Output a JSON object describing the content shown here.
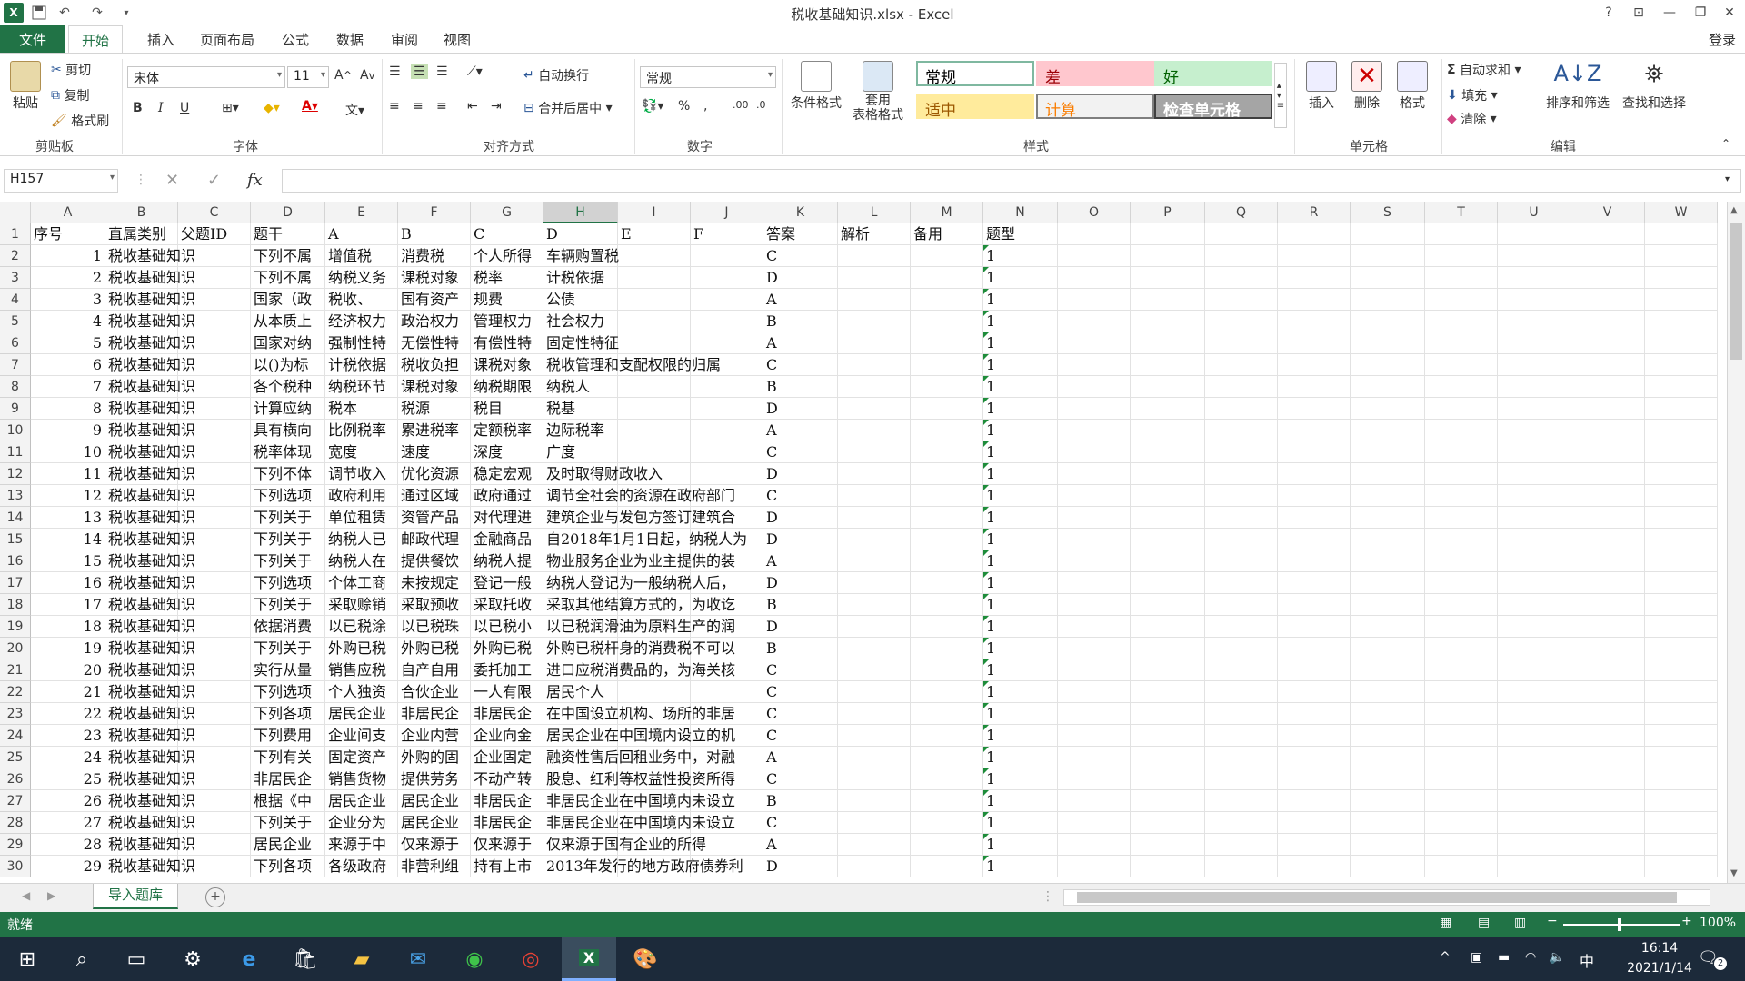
{
  "app": {
    "window_title": "税收基础知识.xlsx - Excel",
    "login": "登录",
    "help": "?",
    "accent": "#217346"
  },
  "tabs": [
    "文件",
    "开始",
    "插入",
    "页面布局",
    "公式",
    "数据",
    "审阅",
    "视图"
  ],
  "ribbon": {
    "clipboard": {
      "paste": "粘贴",
      "cut": "剪切",
      "copy": "复制",
      "format_painter": "格式刷",
      "label": "剪贴板"
    },
    "font": {
      "name": "宋体",
      "size": "11",
      "label": "字体",
      "bold": "B",
      "italic": "I",
      "underline": "U"
    },
    "alignment": {
      "wrap": "自动换行",
      "merge": "合并后居中",
      "label": "对齐方式"
    },
    "number": {
      "format": "常规",
      "label": "数字"
    },
    "styles": {
      "conditional": "条件格式",
      "table": "套用\n表格格式",
      "label": "样式",
      "cells": [
        {
          "text": "常规",
          "bg": "#ffffff",
          "fg": "#000000",
          "border": "#7fb8a0"
        },
        {
          "text": "差",
          "bg": "#ffc7ce",
          "fg": "#9c0006",
          "border": "#ffc7ce"
        },
        {
          "text": "好",
          "bg": "#c6efce",
          "fg": "#006100",
          "border": "#c6efce"
        },
        {
          "text": "适中",
          "bg": "#ffeb9c",
          "fg": "#9c5700",
          "border": "#ffeb9c"
        },
        {
          "text": "计算",
          "bg": "#f2f2f2",
          "fg": "#fa7d00",
          "border": "#7f7f7f"
        },
        {
          "text": "检查单元格",
          "bg": "#a5a5a5",
          "fg": "#ffffff",
          "border": "#3f3f3f"
        }
      ]
    },
    "cells": {
      "insert": "插入",
      "delete": "删除",
      "format": "格式",
      "label": "单元格"
    },
    "editing": {
      "autosum": "自动求和",
      "fill": "填充",
      "clear": "清除",
      "sort": "排序和筛选",
      "find": "查找和选择",
      "label": "编辑"
    }
  },
  "formula_bar": {
    "name_box": "H157",
    "fx": "fx",
    "value": ""
  },
  "columns": [
    "A",
    "B",
    "C",
    "D",
    "E",
    "F",
    "G",
    "H",
    "I",
    "J",
    "K",
    "L",
    "M",
    "N",
    "O",
    "P",
    "Q",
    "R",
    "S",
    "T",
    "U",
    "V",
    "W"
  ],
  "header_row": [
    "序号",
    "直属类别",
    "父题ID",
    "题干",
    "A",
    "B",
    "C",
    "D",
    "E",
    "F",
    "答案",
    "解析",
    "备用",
    "题型"
  ],
  "rows": [
    [
      "1",
      "税收基础知识",
      "",
      "下列不属",
      "增值税",
      "消费税",
      "个人所得",
      "车辆购置税",
      "",
      "",
      "C",
      "",
      "",
      "1"
    ],
    [
      "2",
      "税收基础知识",
      "",
      "下列不属",
      "纳税义务",
      "课税对象",
      "税率",
      "计税依据",
      "",
      "",
      "D",
      "",
      "",
      "1"
    ],
    [
      "3",
      "税收基础知识",
      "",
      "国家（政",
      "税收、",
      "国有资产",
      "规费",
      "公债",
      "",
      "",
      "A",
      "",
      "",
      "1"
    ],
    [
      "4",
      "税收基础知识",
      "",
      "从本质上",
      "经济权力",
      "政治权力",
      "管理权力",
      "社会权力",
      "",
      "",
      "B",
      "",
      "",
      "1"
    ],
    [
      "5",
      "税收基础知识",
      "",
      "国家对纳",
      "强制性特",
      "无偿性特",
      "有偿性特",
      "固定性特征",
      "",
      "",
      "A",
      "",
      "",
      "1"
    ],
    [
      "6",
      "税收基础知识",
      "",
      "以()为标",
      "计税依据",
      "税收负担",
      "课税对象",
      "税收管理和支配权限的归属",
      "",
      "",
      "C",
      "",
      "",
      "1"
    ],
    [
      "7",
      "税收基础知识",
      "",
      "各个税种",
      "纳税环节",
      "课税对象",
      "纳税期限",
      "纳税人",
      "",
      "",
      "B",
      "",
      "",
      "1"
    ],
    [
      "8",
      "税收基础知识",
      "",
      "计算应纳",
      "税本",
      "税源",
      "税目",
      "税基",
      "",
      "",
      "D",
      "",
      "",
      "1"
    ],
    [
      "9",
      "税收基础知识",
      "",
      "具有横向",
      "比例税率",
      "累进税率",
      "定额税率",
      "边际税率",
      "",
      "",
      "A",
      "",
      "",
      "1"
    ],
    [
      "10",
      "税收基础知识",
      "",
      "税率体现",
      "宽度",
      "速度",
      "深度",
      "广度",
      "",
      "",
      "C",
      "",
      "",
      "1"
    ],
    [
      "11",
      "税收基础知识",
      "",
      "下列不体",
      "调节收入",
      "优化资源",
      "稳定宏观",
      "及时取得财政收入",
      "",
      "",
      "D",
      "",
      "",
      "1"
    ],
    [
      "12",
      "税收基础知识",
      "",
      "下列选项",
      "政府利用",
      "通过区域",
      "政府通过",
      "调节全社会的资源在政府部门",
      "",
      "",
      "C",
      "",
      "",
      "1"
    ],
    [
      "13",
      "税收基础知识",
      "",
      "下列关于",
      "单位租赁",
      "资管产品",
      "对代理进",
      "建筑企业与发包方签订建筑合",
      "",
      "",
      "D",
      "",
      "",
      "1"
    ],
    [
      "14",
      "税收基础知识",
      "",
      "下列关于",
      "纳税人已",
      "邮政代理",
      "金融商品",
      "自2018年1月1日起，纳税人为",
      "",
      "",
      "D",
      "",
      "",
      "1"
    ],
    [
      "15",
      "税收基础知识",
      "",
      "下列关于",
      "纳税人在",
      "提供餐饮",
      "纳税人提",
      "物业服务企业为业主提供的装",
      "",
      "",
      "A",
      "",
      "",
      "1"
    ],
    [
      "16",
      "税收基础知识",
      "",
      "下列选项",
      "个体工商",
      "未按规定",
      "登记一般",
      "纳税人登记为一般纳税人后，",
      "",
      "",
      "D",
      "",
      "",
      "1"
    ],
    [
      "17",
      "税收基础知识",
      "",
      "下列关于",
      "采取赊销",
      "采取预收",
      "采取托收",
      "采取其他结算方式的，为收讫",
      "",
      "",
      "B",
      "",
      "",
      "1"
    ],
    [
      "18",
      "税收基础知识",
      "",
      "依据消费",
      "以已税涂",
      "以已税珠",
      "以已税小",
      "以已税润滑油为原料生产的润",
      "",
      "",
      "D",
      "",
      "",
      "1"
    ],
    [
      "19",
      "税收基础知识",
      "",
      "下列关于",
      "外购已税",
      "外购已税",
      "外购已税",
      "外购已税杆身的消费税不可以",
      "",
      "",
      "B",
      "",
      "",
      "1"
    ],
    [
      "20",
      "税收基础知识",
      "",
      "实行从量",
      "销售应税",
      "自产自用",
      "委托加工",
      "进口应税消费品的，为海关核",
      "",
      "",
      "C",
      "",
      "",
      "1"
    ],
    [
      "21",
      "税收基础知识",
      "",
      "下列选项",
      "个人独资",
      "合伙企业",
      "一人有限",
      "居民个人",
      "",
      "",
      "C",
      "",
      "",
      "1"
    ],
    [
      "22",
      "税收基础知识",
      "",
      "下列各项",
      "居民企业",
      "非居民企",
      "非居民企",
      "在中国设立机构、场所的非居",
      "",
      "",
      "C",
      "",
      "",
      "1"
    ],
    [
      "23",
      "税收基础知识",
      "",
      "下列费用",
      "企业间支",
      "企业内营",
      "企业向金",
      "居民企业在中国境内设立的机",
      "",
      "",
      "C",
      "",
      "",
      "1"
    ],
    [
      "24",
      "税收基础知识",
      "",
      "下列有关",
      "固定资产",
      "外购的固",
      "企业固定",
      "融资性售后回租业务中，对融",
      "",
      "",
      "A",
      "",
      "",
      "1"
    ],
    [
      "25",
      "税收基础知识",
      "",
      "非居民企",
      "销售货物",
      "提供劳务",
      "不动产转",
      "股息、红利等权益性投资所得",
      "",
      "",
      "C",
      "",
      "",
      "1"
    ],
    [
      "26",
      "税收基础知识",
      "",
      "根据《中",
      "居民企业",
      "居民企业",
      "非居民企",
      "非居民企业在中国境内未设立",
      "",
      "",
      "B",
      "",
      "",
      "1"
    ],
    [
      "27",
      "税收基础知识",
      "",
      "下列关于",
      "企业分为",
      "居民企业",
      "非居民企",
      "非居民企业在中国境内未设立",
      "",
      "",
      "C",
      "",
      "",
      "1"
    ],
    [
      "28",
      "税收基础知识",
      "",
      "居民企业",
      "来源于中",
      "仅来源于",
      "仅来源于",
      "仅来源于国有企业的所得",
      "",
      "",
      "A",
      "",
      "",
      "1"
    ],
    [
      "29",
      "税收基础知识",
      "",
      "下列各项",
      "各级政府",
      "非营利组",
      "持有上市",
      "2013年发行的地方政府债券利",
      "",
      "",
      "D",
      "",
      "",
      "1"
    ]
  ],
  "sheet": {
    "active": "导入题库",
    "add": "+"
  },
  "status": {
    "ready": "就绪",
    "zoom": "100%"
  },
  "taskbar": {
    "time": "16:14",
    "date": "2021/1/14",
    "ime": "中",
    "notif": "2"
  }
}
